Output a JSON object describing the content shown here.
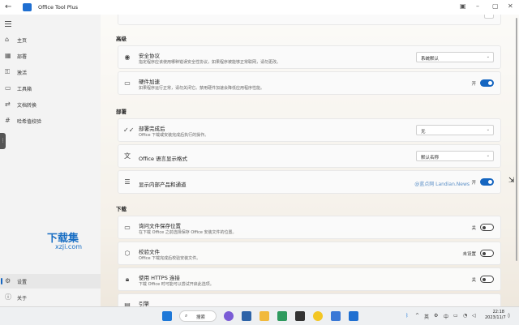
{
  "app": {
    "title": "Office Tool Plus"
  },
  "sidebar": {
    "items": [
      {
        "label": "主页",
        "icon": "home-icon"
      },
      {
        "label": "部署",
        "icon": "deploy-icon"
      },
      {
        "label": "激活",
        "icon": "key-icon"
      },
      {
        "label": "工具箱",
        "icon": "toolbox-icon"
      },
      {
        "label": "文档转换",
        "icon": "convert-icon"
      },
      {
        "label": "哈希值校验",
        "icon": "hash-icon"
      }
    ],
    "bottom_items": [
      {
        "label": "设置",
        "icon": "gear-icon"
      },
      {
        "label": "关于",
        "icon": "info-icon"
      }
    ]
  },
  "watermark_logo": {
    "title": "下载集",
    "url": "xzji.com"
  },
  "sections": {
    "advanced": {
      "header": "高级",
      "protocol": {
        "title": "安全协议",
        "desc": "指定程序应该使用哪种错误安全性协议，如果程序被能够正常联网，请勿更改。",
        "value": "系统默认"
      },
      "hwaccel": {
        "title": "硬件加速",
        "desc": "如果程序运行正常，请勿关闭它。禁用硬件加速会降低应用程序性能。",
        "state": "开"
      }
    },
    "deploy": {
      "header": "部署",
      "after": {
        "title": "部署完成后",
        "desc": "Office 下载或安装完成后执行的操作。",
        "value": "无"
      },
      "langfmt": {
        "title": "Office 语言显示格式",
        "value": "默认名称"
      },
      "internal": {
        "title": "显示内部产品和通道",
        "state": "开",
        "watermark": "@蓝点网 Landian.News"
      }
    },
    "download": {
      "header": "下载",
      "askpath": {
        "title": "询问文件保存位置",
        "desc": "在下载 Office 之前选择保存 Office 安装文件的位置。",
        "state": "关"
      },
      "verify": {
        "title": "校验文件",
        "desc": "Office 下载完成后校验安装文件。",
        "state": "未设置"
      },
      "https": {
        "title": "使用 HTTPS 连接",
        "desc": "下载 Office 时可能可以尝试开启此选项。",
        "state": "关"
      },
      "engine": {
        "title": "引擎"
      }
    }
  },
  "taskbar": {
    "search_label": "搜索",
    "tray": {
      "lang1": "英",
      "lang2": "中"
    },
    "time": "22:18",
    "date": "2023/11/7"
  }
}
